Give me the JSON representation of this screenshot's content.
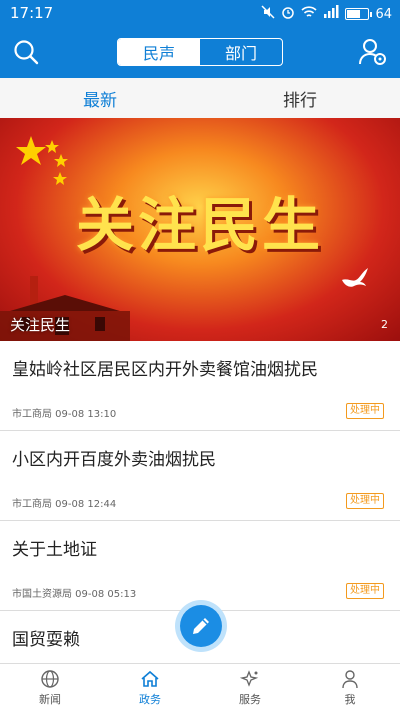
{
  "status": {
    "time": "17:17",
    "battery": "64",
    "battery_level": 0.64
  },
  "header": {
    "seg_left": "民声",
    "seg_right": "部门"
  },
  "tabs": [
    {
      "label": "最新"
    },
    {
      "label": "排行"
    }
  ],
  "banner": {
    "headline": "关注民生",
    "caption": "关注民生",
    "count": "2"
  },
  "list": [
    {
      "title": "皇姑岭社区居民区内开外卖餐馆油烟扰民",
      "meta": "市工商局 09-08 13:10",
      "badge": "处理中"
    },
    {
      "title": "小区内开百度外卖油烟扰民",
      "meta": "市工商局 09-08 12:44",
      "badge": "处理中"
    },
    {
      "title": "关于土地证",
      "meta": "市国土资源局 09-08 05:13",
      "badge": "处理中"
    },
    {
      "title": "国贸耍赖",
      "meta": "",
      "badge": ""
    }
  ],
  "nav": [
    {
      "label": "新闻"
    },
    {
      "label": "政务"
    },
    {
      "label": "服务"
    },
    {
      "label": "我"
    }
  ],
  "colors": {
    "primary": "#0f7fd6",
    "badge": "#f39a1e"
  }
}
